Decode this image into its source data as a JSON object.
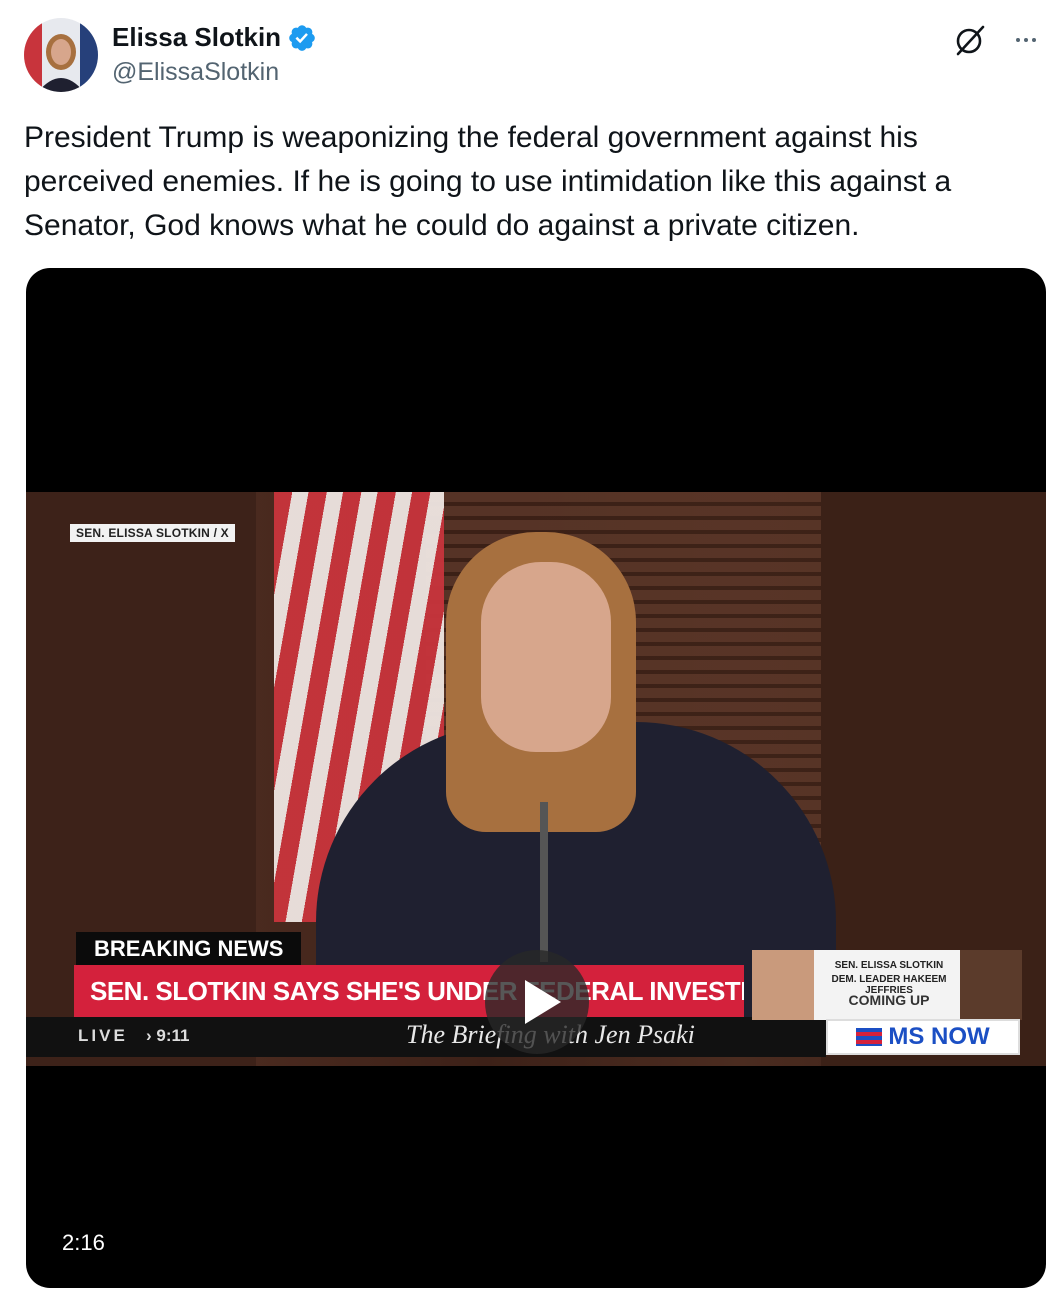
{
  "author": {
    "display_name": "Elissa Slotkin",
    "handle": "@ElissaSlotkin",
    "verified_icon": "verified-badge-icon",
    "verified_color": "#1d9bf0"
  },
  "actions": {
    "grok_icon": "grok-icon",
    "more_icon": "more-options-icon"
  },
  "tweet": {
    "text": "President Trump is weaponizing the federal government against his perceived enemies. If he is going to use intimidation like this against a Senator, God knows what he could do against a private citizen."
  },
  "video": {
    "source_label": "SEN. ELISSA SLOTKIN / X",
    "breaking_tag": "BREAKING NEWS",
    "headline": "SEN. SLOTKIN SAYS SHE'S UNDER FEDERAL INVESTIGATION OVER VIRAL VIDEO",
    "live_label": "LIVE",
    "time": "› 9:11",
    "show_title": "The Briefing with Jen Psaki",
    "coming_line1": "SEN. ELISSA SLOTKIN",
    "coming_line2": "DEM. LEADER HAKEEM JEFFRIES",
    "coming_line3": "COMING UP",
    "network": "MS NOW",
    "play_icon": "play-icon",
    "duration": "2:16",
    "headline_color": "#d4213c",
    "network_color": "#1b4fc4"
  }
}
